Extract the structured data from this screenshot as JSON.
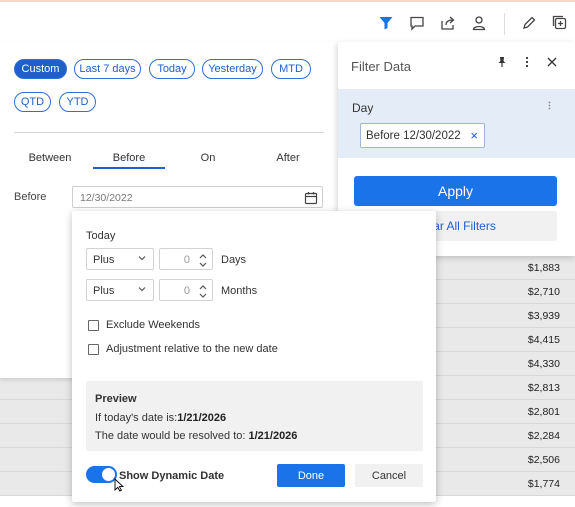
{
  "toolbar": {
    "icons": [
      "filter-icon",
      "comment-icon",
      "share-icon",
      "user-icon",
      "edit-icon",
      "add-icon"
    ],
    "accent_color": "#1a73e8"
  },
  "presets": {
    "chips": [
      "Custom",
      "Last 7 days",
      "Today",
      "Yesterday",
      "MTD",
      "QTD",
      "YTD"
    ],
    "active": "Custom"
  },
  "range_tabs": {
    "items": [
      "Between",
      "Before",
      "On",
      "After"
    ],
    "active": "Before"
  },
  "date_field": {
    "label": "Before",
    "value": "12/30/2022"
  },
  "filter_panel": {
    "title": "Filter Data",
    "field_label": "Day",
    "tag_value": "Before 12/30/2022",
    "apply_label": "Apply",
    "clear_label": "Clear All Filters"
  },
  "dynamic_date": {
    "today_label": "Today",
    "rows": [
      {
        "operator": "Plus",
        "amount": "0",
        "unit": "Days"
      },
      {
        "operator": "Plus",
        "amount": "0",
        "unit": "Months"
      }
    ],
    "exclude_weekends_label": "Exclude Weekends",
    "adjustment_label": "Adjustment relative to the new date",
    "preview_title": "Preview",
    "preview_today_text": "If today's date is:",
    "preview_today_value": "1/21/2026",
    "preview_resolved_text": "The date would be resolved to: ",
    "preview_resolved_value": "1/21/2026",
    "toggle_label": "Show Dynamic Date",
    "toggle_on": true,
    "done_label": "Done",
    "cancel_label": "Cancel"
  },
  "table": {
    "values": [
      "$1,883",
      "$2,710",
      "$3,939",
      "$4,415",
      "$4,330",
      "$2,813",
      "$2,801",
      "$2,284",
      "$2,506",
      "$1,774"
    ]
  }
}
